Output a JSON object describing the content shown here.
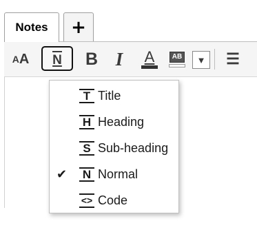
{
  "tabs": [
    {
      "label": "Notes"
    },
    {
      "label": "+"
    }
  ],
  "toolbar": {
    "font_size_small": "A",
    "font_size_big": "A",
    "style_icon_glyph": "N",
    "bold_label": "B",
    "italic_label": "I",
    "font_color_label": "A",
    "highlight_label": "AB",
    "dropdown_arrow": "▼",
    "list_icon": "☰"
  },
  "style_menu": {
    "items": [
      {
        "glyph": "T",
        "label": "Title",
        "checked": false
      },
      {
        "glyph": "H",
        "label": "Heading",
        "checked": false
      },
      {
        "glyph": "S",
        "label": "Sub-heading",
        "checked": false
      },
      {
        "glyph": "N",
        "label": "Normal",
        "checked": true
      },
      {
        "glyph": "<>",
        "label": "Code",
        "checked": false
      }
    ],
    "check_mark": "✔"
  },
  "icons": {
    "style": "text-style-icon",
    "bold": "bold-icon",
    "italic": "italic-icon",
    "font_color": "font-color-icon",
    "highlight": "highlight-icon",
    "dropdown": "chevron-down-icon",
    "list": "bullet-list-icon"
  }
}
